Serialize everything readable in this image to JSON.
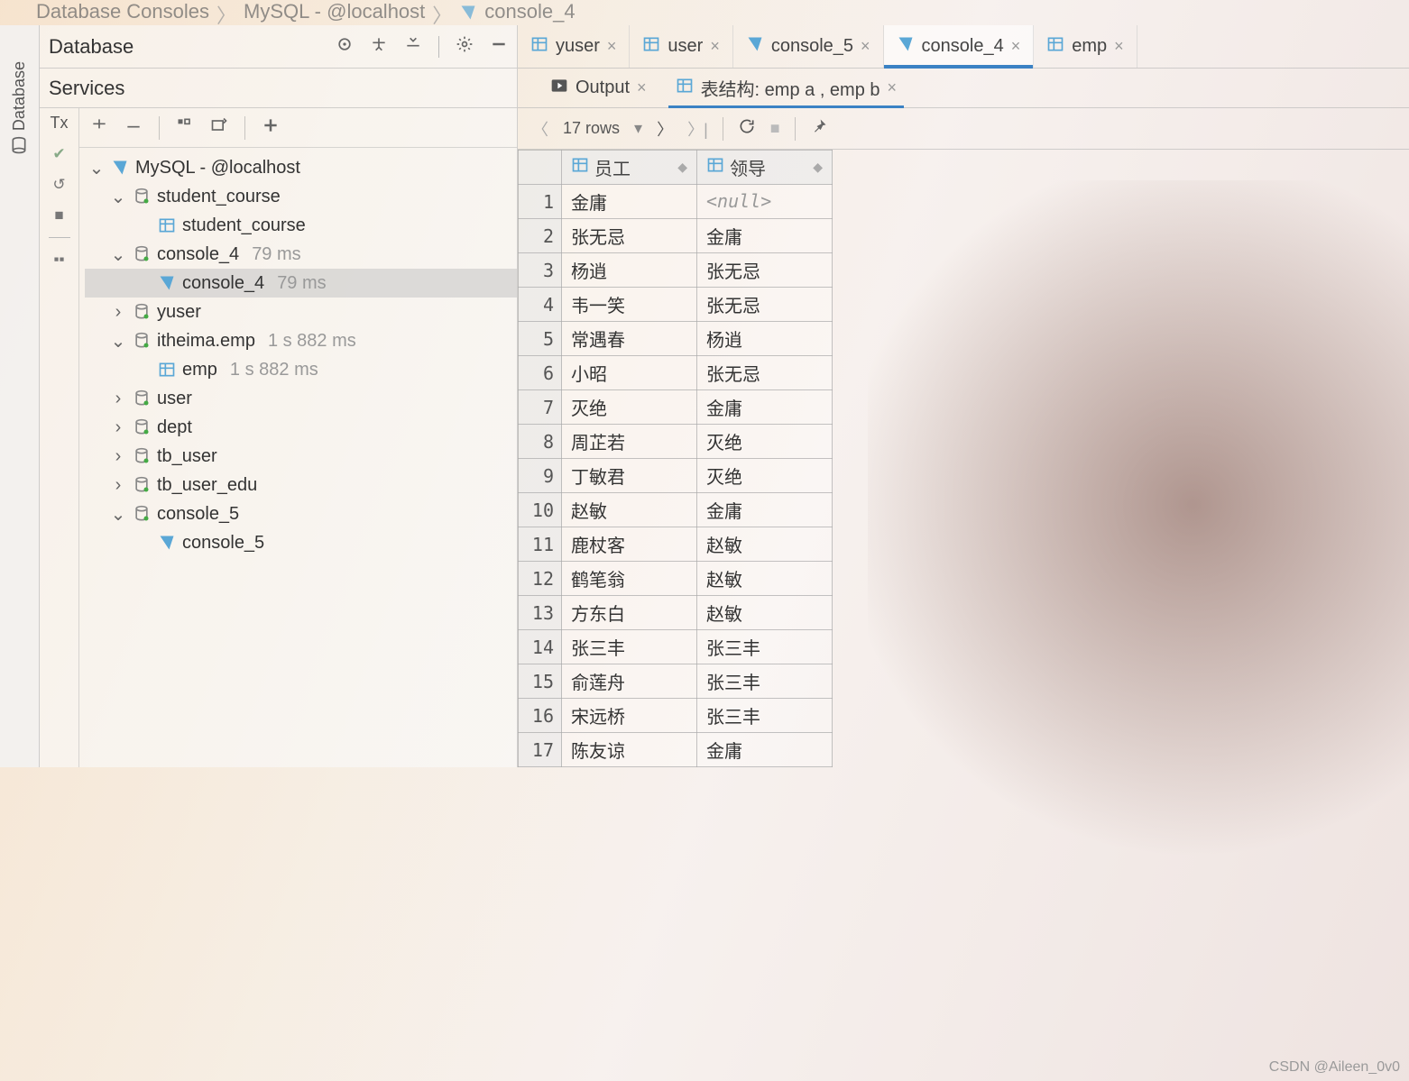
{
  "breadcrumb": [
    "Database Consoles",
    "MySQL - @localhost",
    "console_4"
  ],
  "panels": {
    "database_title": "Database",
    "services_title": "Services",
    "tx_label": "Tx",
    "left_rail_label": "Database"
  },
  "db_tools": {
    "target": "target-icon",
    "expand": "expand-all-icon",
    "collapse": "collapse-all-icon",
    "settings": "gear-icon",
    "minimize": "minimize-icon"
  },
  "tree": {
    "root": {
      "label": "MySQL - @localhost"
    },
    "nodes": [
      {
        "label": "student_course",
        "children": [
          {
            "label": "student_course",
            "type": "table"
          }
        ],
        "expanded": true
      },
      {
        "label": "console_4",
        "time": "79 ms",
        "expanded": true,
        "children": [
          {
            "label": "console_4",
            "time": "79 ms",
            "type": "console",
            "selected": true
          }
        ]
      },
      {
        "label": "yuser",
        "expanded": false
      },
      {
        "label": "itheima.emp",
        "time": "1 s 882 ms",
        "expanded": true,
        "children": [
          {
            "label": "emp",
            "time": "1 s 882 ms",
            "type": "table"
          }
        ]
      },
      {
        "label": "user",
        "expanded": false
      },
      {
        "label": "dept",
        "expanded": false
      },
      {
        "label": "tb_user",
        "expanded": false
      },
      {
        "label": "tb_user_edu",
        "expanded": false
      },
      {
        "label": "console_5",
        "expanded": true,
        "children": [
          {
            "label": "console_5",
            "type": "console"
          }
        ]
      }
    ]
  },
  "editor_tabs": [
    {
      "label": "yuser",
      "icon": "table",
      "active": false
    },
    {
      "label": "user",
      "icon": "table",
      "active": false
    },
    {
      "label": "console_5",
      "icon": "console",
      "active": false
    },
    {
      "label": "console_4",
      "icon": "console",
      "active": true
    },
    {
      "label": "emp",
      "icon": "table",
      "active": false
    }
  ],
  "result_tabs": [
    {
      "label": "Output",
      "icon": "play",
      "active": false
    },
    {
      "label": "表结构: emp a , emp b",
      "icon": "table",
      "active": true
    }
  ],
  "result_toolbar": {
    "rows_label": "17 rows"
  },
  "grid": {
    "columns": [
      "员工",
      "领导"
    ],
    "rows": [
      [
        "金庸",
        null
      ],
      [
        "张无忌",
        "金庸"
      ],
      [
        "杨逍",
        "张无忌"
      ],
      [
        "韦一笑",
        "张无忌"
      ],
      [
        "常遇春",
        "杨逍"
      ],
      [
        "小昭",
        "张无忌"
      ],
      [
        "灭绝",
        "金庸"
      ],
      [
        "周芷若",
        "灭绝"
      ],
      [
        "丁敏君",
        "灭绝"
      ],
      [
        "赵敏",
        "金庸"
      ],
      [
        "鹿杖客",
        "赵敏"
      ],
      [
        "鹤笔翁",
        "赵敏"
      ],
      [
        "方东白",
        "赵敏"
      ],
      [
        "张三丰",
        "张三丰"
      ],
      [
        "俞莲舟",
        "张三丰"
      ],
      [
        "宋远桥",
        "张三丰"
      ],
      [
        "陈友谅",
        "金庸"
      ]
    ]
  },
  "watermark": "CSDN @Aileen_0v0"
}
